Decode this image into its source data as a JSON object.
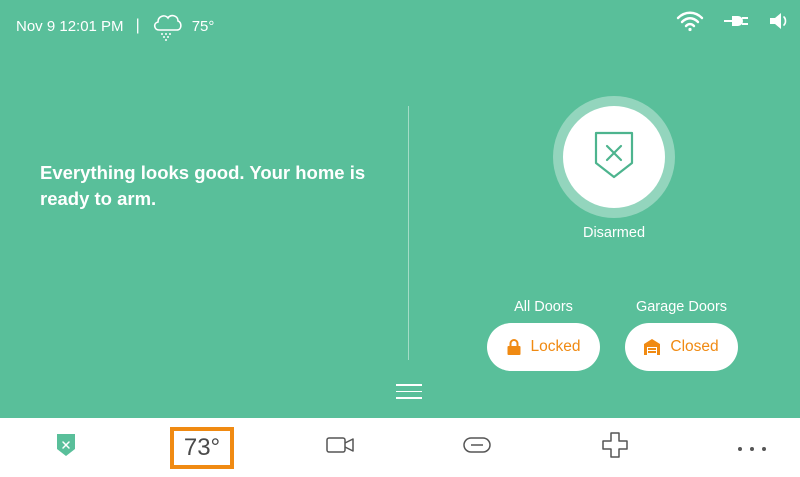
{
  "status": {
    "datetime": "Nov 9 12:01 PM",
    "separator": "|",
    "weather_icon": "cloud-rain-icon",
    "outdoor_temp": "75°",
    "icons": [
      "wifi-icon",
      "power-plug-icon",
      "speaker-icon"
    ]
  },
  "message": "Everything looks good. Your home is ready to arm.",
  "arm": {
    "label": "Disarmed",
    "icon": "shield-x-icon"
  },
  "doors": [
    {
      "group": "All Doors",
      "state": "Locked",
      "icon": "lock-icon"
    },
    {
      "group": "Garage Doors",
      "state": "Closed",
      "icon": "garage-icon"
    }
  ],
  "nav": {
    "thermostat": "73°",
    "items": [
      "security-shield-icon",
      "thermostat",
      "camera-icon",
      "toggle-icon",
      "health-cross-icon",
      "more-dots-icon"
    ]
  },
  "colors": {
    "background": "#59bf9a",
    "accent": "#f08a12",
    "shield_green": "#4db48e"
  }
}
